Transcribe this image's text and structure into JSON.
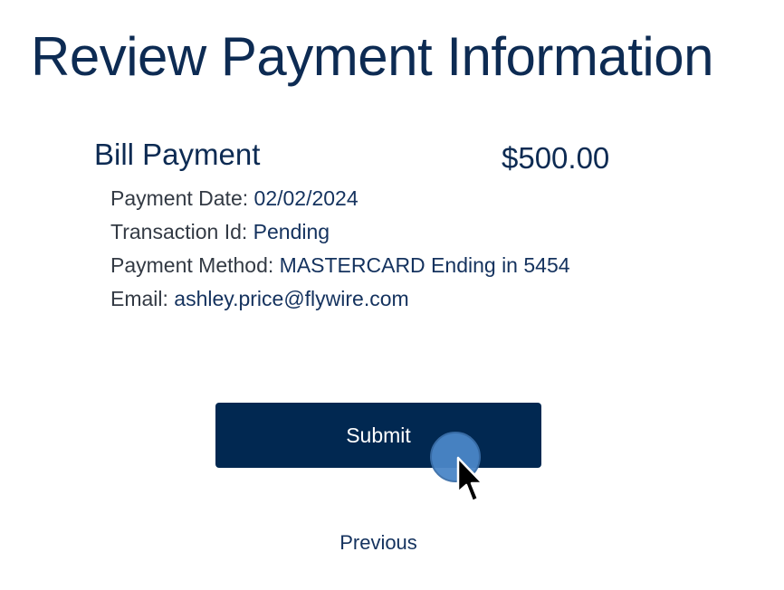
{
  "page": {
    "title": "Review Payment Information"
  },
  "bill": {
    "title": "Bill Payment",
    "amount": "$500.00",
    "details": [
      {
        "label": "Payment Date: ",
        "value": "02/02/2024"
      },
      {
        "label": "Transaction Id: ",
        "value": "Pending"
      },
      {
        "label": "Payment Method: ",
        "value": "MASTERCARD Ending in 5454"
      },
      {
        "label": "Email: ",
        "value": "ashley.price@flywire.com"
      }
    ]
  },
  "actions": {
    "submit_label": "Submit",
    "previous_label": "Previous"
  },
  "colors": {
    "primary": "#012851",
    "heading": "#0d2b53",
    "click_indicator": "#4a86c8"
  },
  "icons": {
    "cursor": "mouse-pointer-icon"
  }
}
